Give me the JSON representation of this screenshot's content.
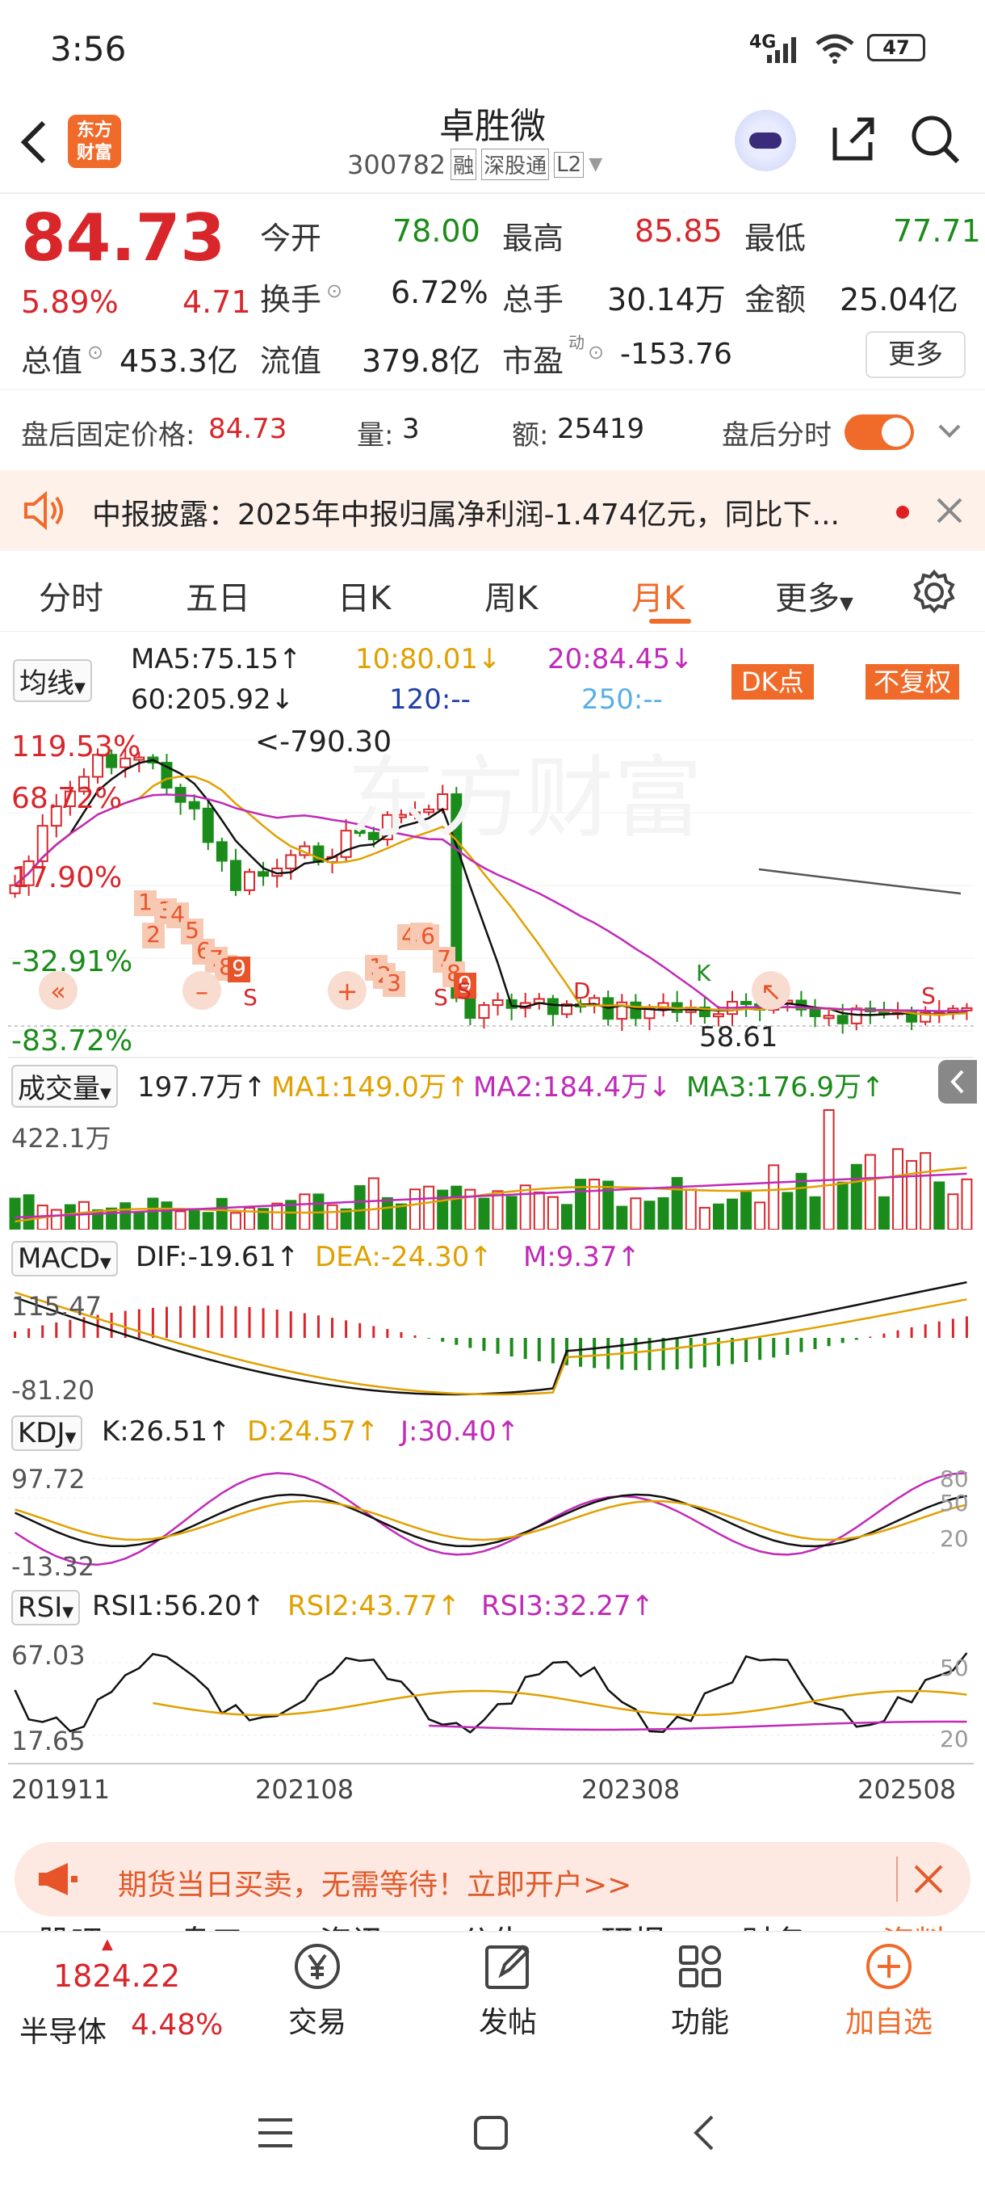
{
  "status": {
    "time": "3:56",
    "network": "4G",
    "battery": "47"
  },
  "header": {
    "title": "卓胜微",
    "code": "300782",
    "tag1": "融",
    "tag2": "深股通",
    "tag3": "L2",
    "logo_line1": "东方",
    "logo_line2": "财富"
  },
  "quote": {
    "price": "84.73",
    "change_pct": "5.89%",
    "change": "4.71",
    "open_label": "今开",
    "open": "78.00",
    "high_label": "最高",
    "high": "85.85",
    "low_label": "最低",
    "low": "77.71",
    "turnover_label": "换手",
    "turnover": "6.72%",
    "volume_label": "总手",
    "volume": "30.14万",
    "amount_label": "金额",
    "amount": "25.04亿",
    "mcap_label": "总值",
    "mcap": "453.3亿",
    "float_label": "流值",
    "float": "379.8亿",
    "pe_label": "市盈",
    "pe_sup": "动",
    "pe": "-153.76",
    "more": "更多"
  },
  "afterhours": {
    "price_label": "盘后固定价格:",
    "price": "84.73",
    "qty_label": "量:",
    "qty": "3",
    "amt_label": "额:",
    "amt": "25419",
    "toggle_label": "盘后分时"
  },
  "notice": {
    "text": "中报披露：2025年中报归属净利润-1.474亿元，同比下..."
  },
  "tabs": [
    "分时",
    "五日",
    "日K",
    "周K",
    "月K",
    "更多"
  ],
  "active_tab": "月K",
  "ma": {
    "selector": "均线",
    "ma5": "MA5:75.15↑",
    "ma10": "10:80.01↓",
    "ma20": "20:84.45↓",
    "ma60": "60:205.92↓",
    "ma120": "120:--",
    "ma250": "250:--",
    "dk": "DK点",
    "fq": "不复权"
  },
  "kline": {
    "y_labels": [
      "119.53%",
      "68.72%",
      "17.90%",
      "-32.91%",
      "-83.72%"
    ],
    "max_label": "<-790.30",
    "min_label": "58.61",
    "markers": [
      "1",
      "2",
      "3",
      "4",
      "5",
      "6",
      "7",
      "8",
      "9",
      "1",
      "2",
      "3",
      "4",
      "5",
      "6",
      "7",
      "8",
      "9",
      "S",
      "S",
      "S",
      "S",
      "S",
      "D",
      "K"
    ]
  },
  "volume": {
    "selector": "成交量",
    "value": "197.7万↑",
    "ma1": "MA1:149.0万↑",
    "ma2": "MA2:184.4万↓",
    "ma3": "MA3:176.9万↑",
    "max": "422.1万"
  },
  "macd": {
    "selector": "MACD",
    "dif": "DIF:-19.61↑",
    "dea": "DEA:-24.30↑",
    "m": "M:9.37↑",
    "top": "115.47",
    "bottom": "-81.20"
  },
  "kdj": {
    "selector": "KDJ",
    "k": "K:26.51↑",
    "d": "D:24.57↑",
    "j": "J:30.40↑",
    "top": "97.72",
    "bottom": "-13.32",
    "r80": "80",
    "r50": "50",
    "r20": "20"
  },
  "rsi": {
    "selector": "RSI",
    "rsi1": "RSI1:56.20↑",
    "rsi2": "RSI2:43.77↑",
    "rsi3": "RSI3:32.27↑",
    "top": "67.03",
    "bottom": "17.65",
    "r50": "50",
    "r20": "20"
  },
  "xaxis": [
    "201911",
    "202108",
    "202308",
    "202508"
  ],
  "ad": {
    "text": "期货当日买卖，无需等待！立即开户>>"
  },
  "subtabs": [
    "股吧",
    "盘口",
    "资讯",
    "公告",
    "研报",
    "财务",
    "资料"
  ],
  "bottom": {
    "index_value": "1824.22",
    "index_name": "半导体",
    "index_pct": "4.48%",
    "trade": "交易",
    "post": "发帖",
    "func": "功能",
    "add": "加自选"
  },
  "colors": {
    "up": "#d8262b",
    "down": "#1b8c1b",
    "accent": "#f06a2a"
  }
}
